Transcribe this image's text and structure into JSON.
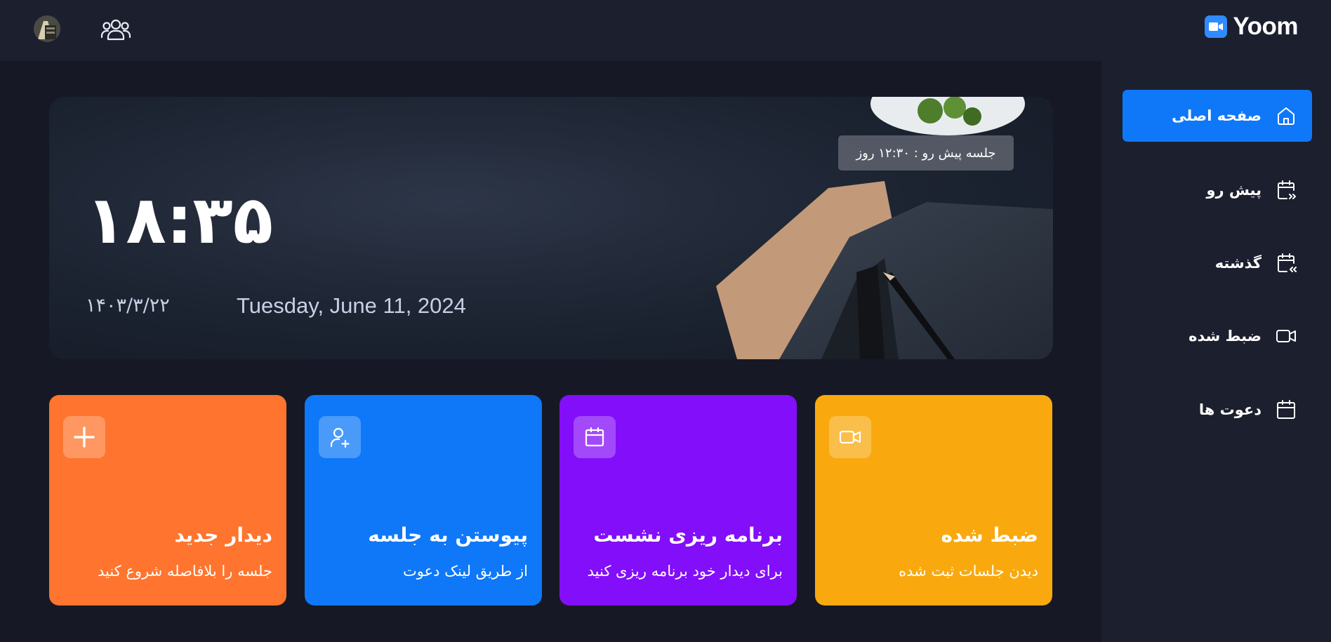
{
  "brand": {
    "name": "Yoom",
    "accent": "#2f8bff"
  },
  "header": {
    "avatar_alt": "user-avatar",
    "people_icon": "users-icon"
  },
  "sidebar": {
    "items": [
      {
        "label": "صفحه اصلی",
        "icon": "home-icon",
        "active": true
      },
      {
        "label": "پیش رو",
        "icon": "calendar-next-icon",
        "active": false
      },
      {
        "label": "گذشته",
        "icon": "calendar-prev-icon",
        "active": false
      },
      {
        "label": "ضبط شده",
        "icon": "video-icon",
        "active": false
      },
      {
        "label": "دعوت ها",
        "icon": "calendar-icon",
        "active": false
      }
    ]
  },
  "hero": {
    "upcoming_badge": "جلسه پیش رو : ۱۲:۳۰ روز",
    "time": "۱۸:۳۵",
    "jalali_date": "۱۴۰۳/۳/۲۲",
    "gregorian_date": "Tuesday, June 11, 2024"
  },
  "cards": [
    {
      "title": "دیدار جدید",
      "subtitle": "جلسه را بلافاصله شروع کنید",
      "icon": "plus-icon",
      "color": "#ff742e"
    },
    {
      "title": "پیوستن به جلسه",
      "subtitle": "از طریق لینک دعوت",
      "icon": "add-user-icon",
      "color": "#0e78f9"
    },
    {
      "title": "برنامه ریزی نشست",
      "subtitle": "برای دیدار خود برنامه ریزی کنید",
      "icon": "calendar-icon",
      "color": "#830ef9"
    },
    {
      "title": "ضبط شده",
      "subtitle": "دیدن جلسات ثبت شده",
      "icon": "video-icon",
      "color": "#f9a90e"
    }
  ]
}
